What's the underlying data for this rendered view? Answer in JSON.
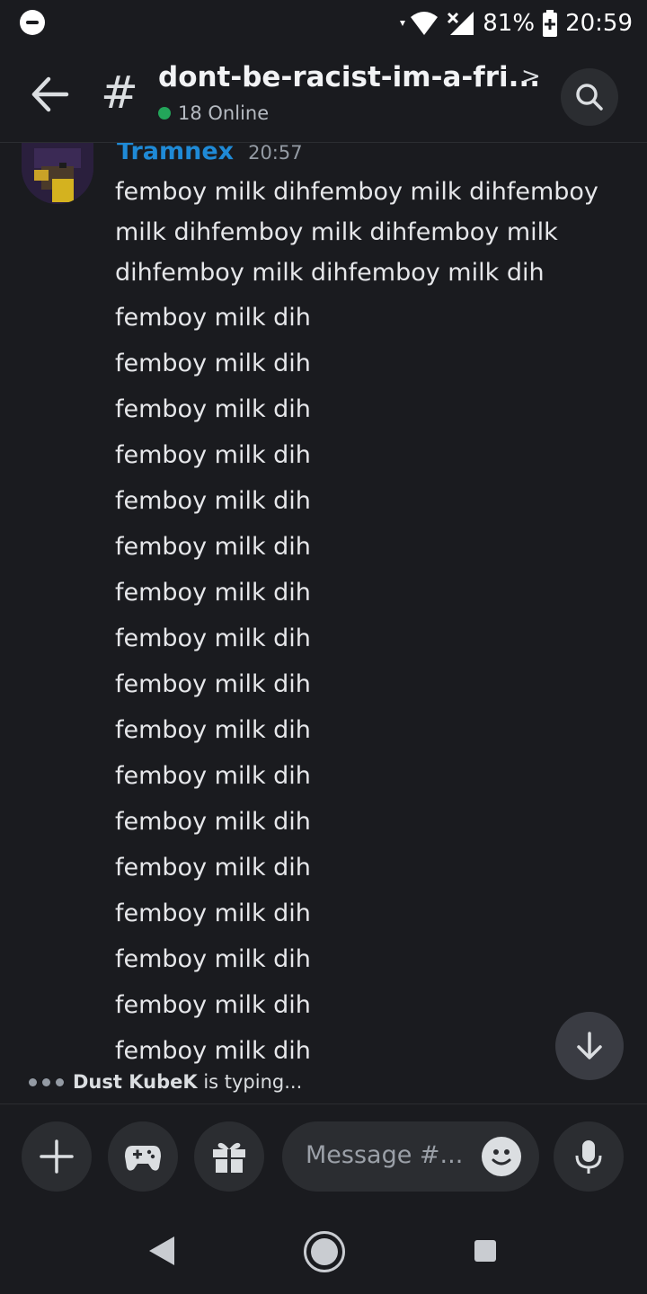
{
  "status_bar": {
    "battery": "81%",
    "time": "20:59",
    "icons": [
      "do-not-disturb-icon",
      "wifi-icon",
      "signal-icon",
      "battery-icon"
    ]
  },
  "header": {
    "channel_name": "dont-be-racist-im-a-fri...",
    "online_count": "18 Online"
  },
  "message_group": {
    "author": "Tramnex",
    "timestamp": "20:57",
    "author_color": "#1f8ad6",
    "messages": [
      "femboy milk dihfemboy milk dihfemboy milk dihfemboy milk dihfemboy milk dihfemboy milk dihfemboy milk dih",
      "femboy milk dih",
      "femboy milk dih",
      "femboy milk dih",
      "femboy milk dih",
      "femboy milk dih",
      "femboy milk dih",
      "femboy milk dih",
      "femboy milk dih",
      "femboy milk dih",
      "femboy milk dih",
      "femboy milk dih",
      "femboy milk dih",
      "femboy milk dih",
      "femboy milk dih",
      "femboy milk dih",
      "femboy milk dih",
      "femboy milk dih"
    ]
  },
  "typing": {
    "user": "Dust KubeK",
    "suffix": " is typing..."
  },
  "composer": {
    "placeholder": "Message #...",
    "buttons": [
      "plus-icon",
      "gamepad-icon",
      "gift-icon",
      "emoji-icon",
      "microphone-icon"
    ]
  },
  "colors": {
    "background": "#1a1b1f",
    "online": "#23a55a"
  }
}
